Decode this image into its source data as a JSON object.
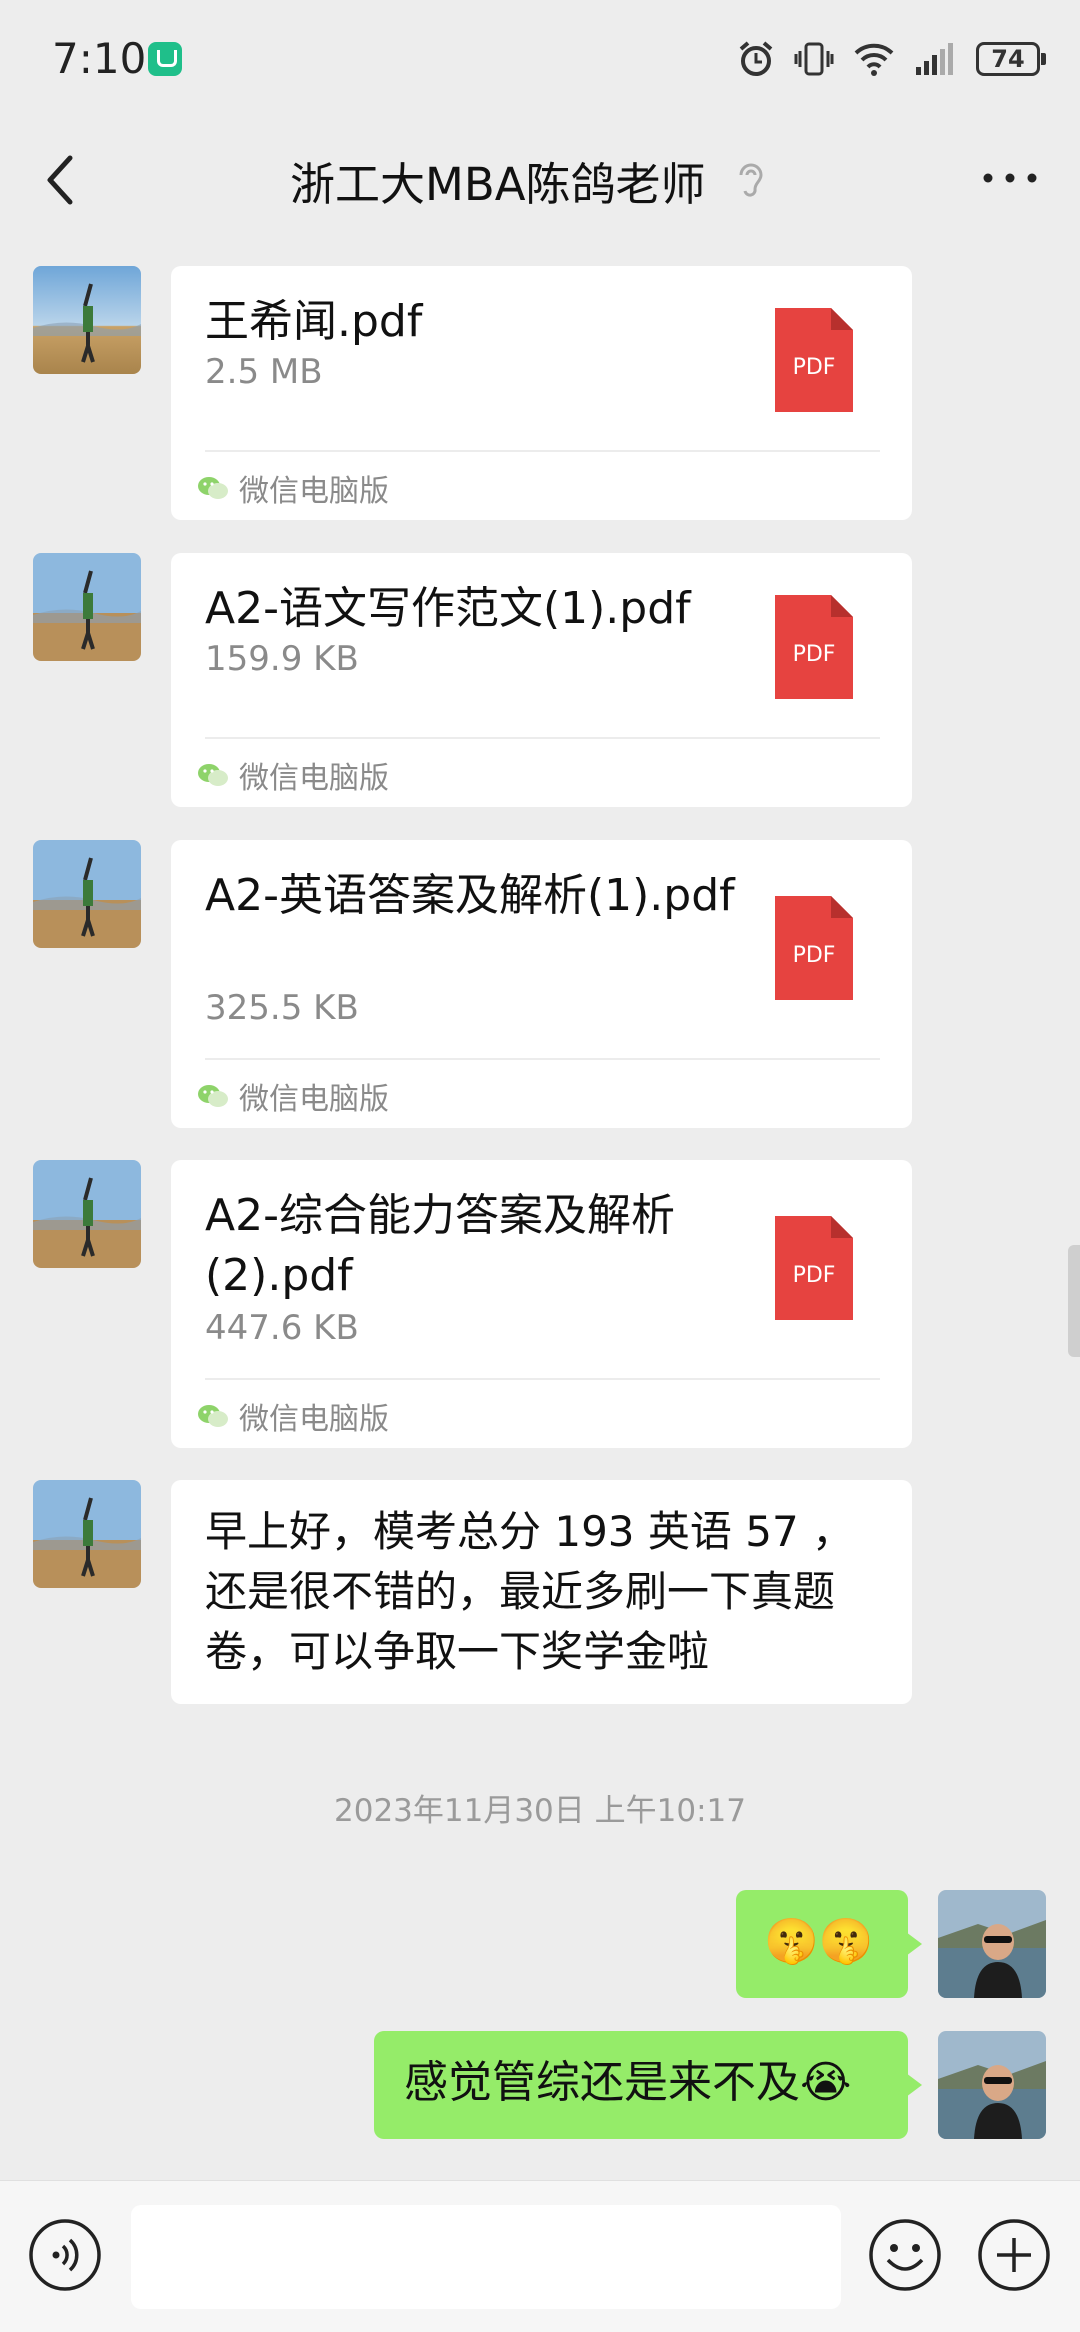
{
  "status_bar": {
    "time": "7:10",
    "battery": "74"
  },
  "header": {
    "title": "浙工大MBA陈鸽老师"
  },
  "messages": [
    {
      "file_name": "王希闻.pdf",
      "file_size": "2.5 MB",
      "source": "微信电脑版",
      "pdf_label": "PDF"
    },
    {
      "file_name": "A2-语文写作范文(1).pdf",
      "file_size": "159.9 KB",
      "source": "微信电脑版",
      "pdf_label": "PDF"
    },
    {
      "file_name": "A2-英语答案及解析(1).pdf",
      "file_size": "325.5 KB",
      "source": "微信电脑版",
      "pdf_label": "PDF"
    },
    {
      "file_name": "A2-综合能力答案及解析(2).pdf",
      "file_size": "447.6 KB",
      "source": "微信电脑版",
      "pdf_label": "PDF"
    }
  ],
  "text_message": "早上好，模考总分 193 英语 57 ，还是很不错的，最近多刷一下真题卷，可以争取一下奖学金啦",
  "timestamp": "2023年11月30日 上午10:17",
  "my_messages": [
    {
      "text": "🤫🤫"
    },
    {
      "text": "感觉管综还是来不及😭"
    }
  ],
  "input": {
    "value": ""
  }
}
